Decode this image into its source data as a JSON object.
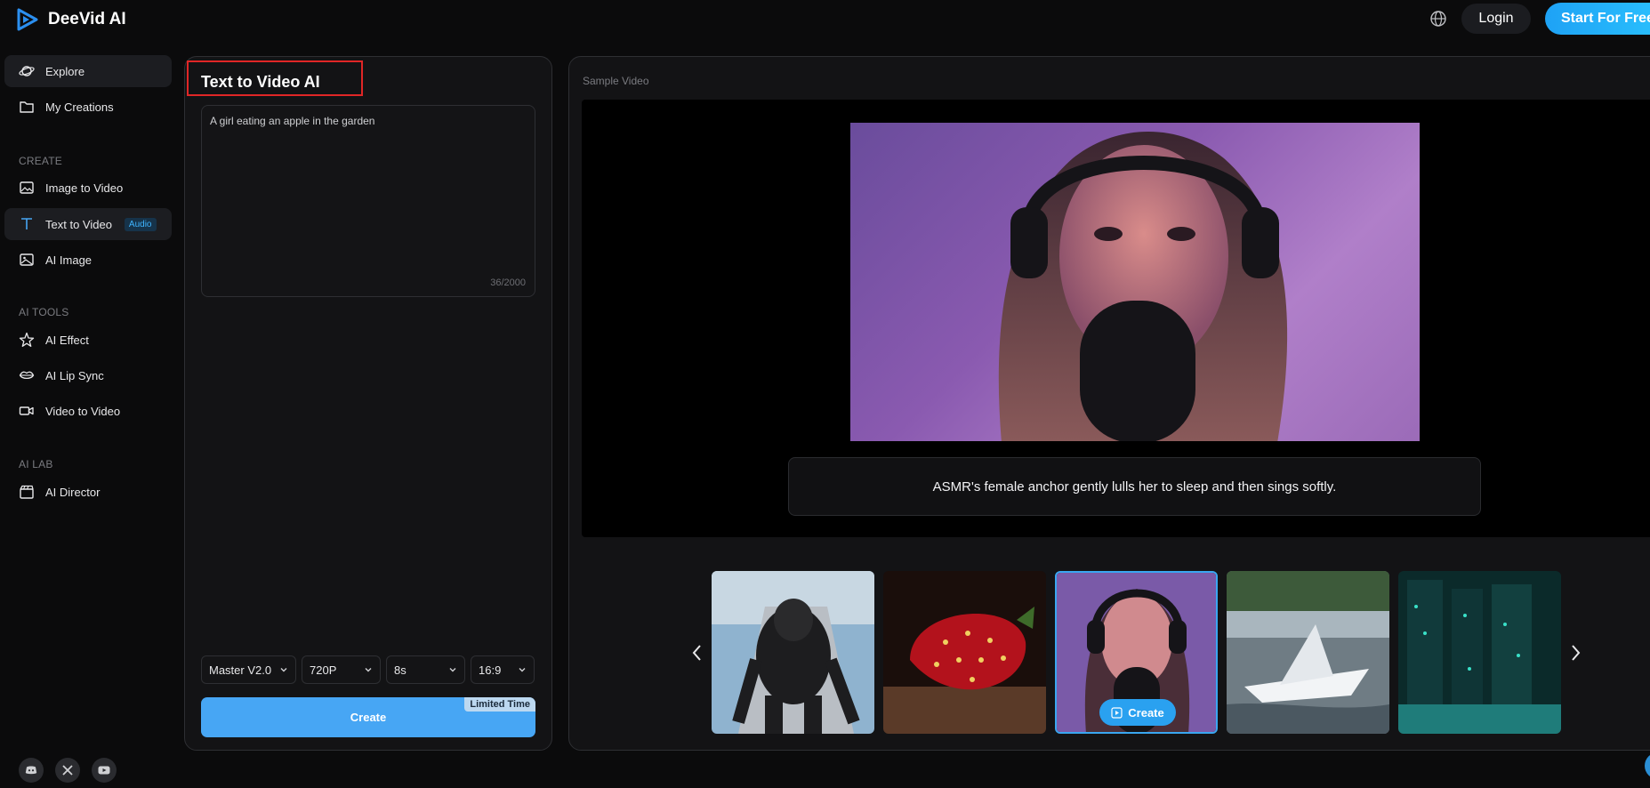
{
  "app": {
    "name": "DeeVid AI"
  },
  "header": {
    "login_label": "Login",
    "start_label": "Start For Free"
  },
  "sidebar": {
    "top_items": [
      {
        "label": "Explore",
        "icon": "planet-icon"
      },
      {
        "label": "My Creations",
        "icon": "folder-icon"
      }
    ],
    "sections": [
      {
        "title": "CREATE",
        "items": [
          {
            "label": "Image to Video",
            "icon": "image-icon"
          },
          {
            "label": "Text to Video",
            "icon": "text-icon",
            "badge": "Audio",
            "active": true
          },
          {
            "label": "AI Image",
            "icon": "ai-image-icon"
          }
        ]
      },
      {
        "title": "AI TOOLS",
        "items": [
          {
            "label": "AI Effect",
            "icon": "sparkle-star-icon"
          },
          {
            "label": "AI Lip Sync",
            "icon": "lips-icon"
          },
          {
            "label": "Video to Video",
            "icon": "video-camera-icon"
          }
        ]
      },
      {
        "title": "AI LAB",
        "items": [
          {
            "label": "AI Director",
            "icon": "clapperboard-icon"
          }
        ]
      }
    ],
    "socials": [
      "discord-icon",
      "x-icon",
      "youtube-icon"
    ]
  },
  "editor": {
    "title": "Text to Video AI",
    "prompt": "A girl eating an apple in the garden",
    "char_count": "36/2000",
    "model": "Master V2.0",
    "resolution": "720P",
    "duration": "8s",
    "aspect_ratio": "16:9",
    "create_label": "Create",
    "limited_label": "Limited Time"
  },
  "preview": {
    "label": "Sample Video",
    "caption": "ASMR's female anchor gently lulls her to sleep and then sings softly.",
    "thumb_create_label": "Create",
    "thumbnails": [
      "gorilla",
      "strawberry",
      "asmr-girl",
      "paper-boat",
      "server-room"
    ],
    "selected_thumb": 2
  },
  "colors": {
    "accent": "#47a6f4",
    "highlight_box": "#e02626",
    "background": "#0b0b0c"
  }
}
